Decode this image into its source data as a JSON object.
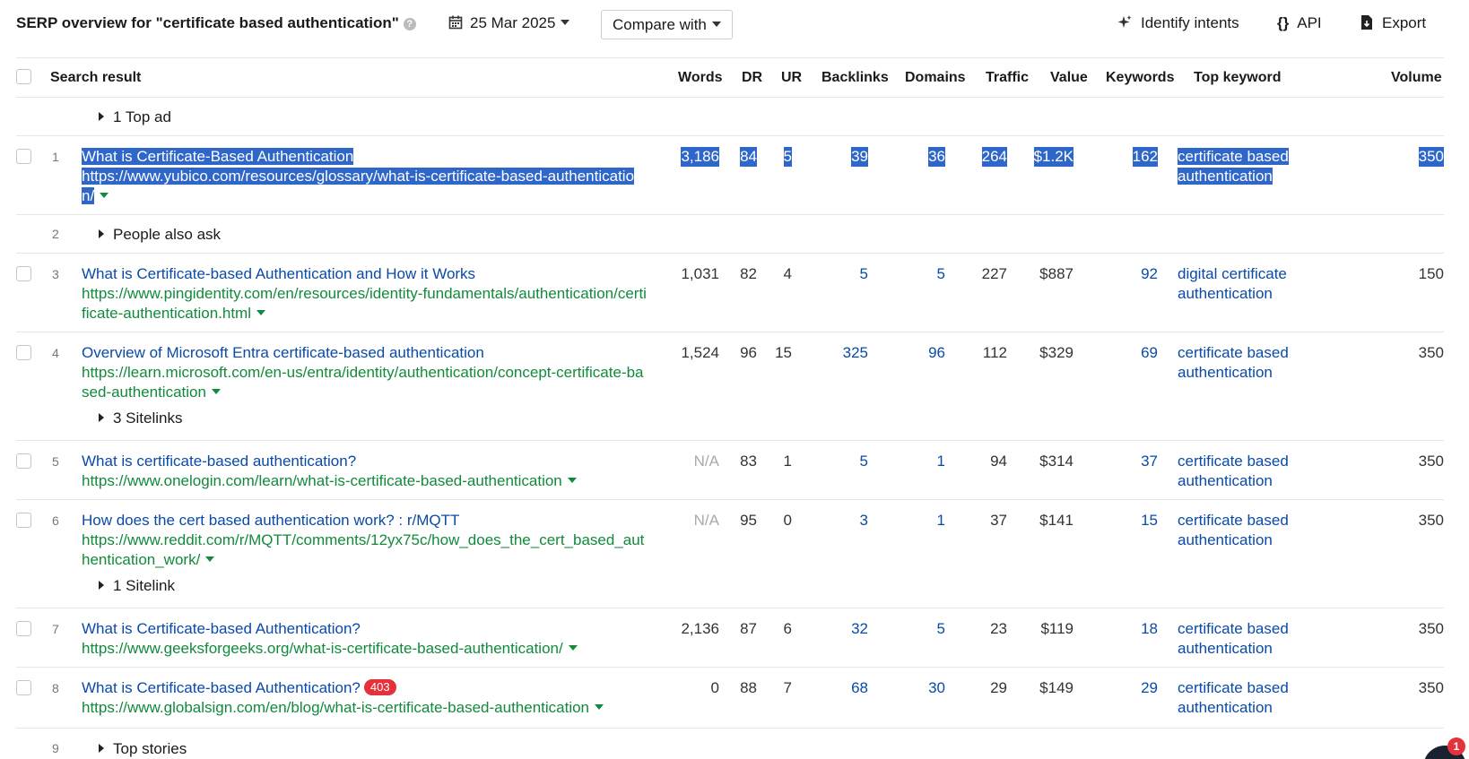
{
  "header": {
    "title": "SERP overview for \"certificate based authentication\"",
    "date": "25 Mar 2025",
    "compare_label": "Compare with",
    "identify_intents": "Identify intents",
    "api": "API",
    "api_glyph": "{}",
    "export": "Export"
  },
  "columns": {
    "result": "Search result",
    "words": "Words",
    "dr": "DR",
    "ur": "UR",
    "backlinks": "Backlinks",
    "domains": "Domains",
    "traffic": "Traffic",
    "value": "Value",
    "keywords": "Keywords",
    "top_keyword": "Top keyword",
    "volume": "Volume"
  },
  "features": {
    "top_ad": "1 Top ad",
    "paa_num": "2",
    "paa": "People also ask",
    "sitelinks_4": "3 Sitelinks",
    "sitelinks_6": "1 Sitelink",
    "stories_num": "9",
    "stories": "Top stories"
  },
  "rows": [
    {
      "num": "1",
      "title": "What is Certificate-Based Authentication",
      "url": "https://www.yubico.com/resources/glossary/what-is-certificate-based-authentication/",
      "words": "3,186",
      "dr": "84",
      "ur": "5",
      "backlinks": "39",
      "domains": "36",
      "traffic": "264",
      "value": "$1.2K",
      "keywords": "162",
      "top_keyword": "certificate based authentication",
      "volume": "350"
    },
    {
      "num": "3",
      "title": "What is Certificate-based Authentication and How it Works",
      "url": "https://www.pingidentity.com/en/resources/identity-fundamentals/authentication/certificate-authentication.html",
      "words": "1,031",
      "dr": "82",
      "ur": "4",
      "backlinks": "5",
      "domains": "5",
      "traffic": "227",
      "value": "$887",
      "keywords": "92",
      "top_keyword": "digital certificate authentication",
      "volume": "150"
    },
    {
      "num": "4",
      "title": "Overview of Microsoft Entra certificate-based authentication",
      "url": "https://learn.microsoft.com/en-us/entra/identity/authentication/concept-certificate-based-authentication",
      "words": "1,524",
      "dr": "96",
      "ur": "15",
      "backlinks": "325",
      "domains": "96",
      "traffic": "112",
      "value": "$329",
      "keywords": "69",
      "top_keyword": "certificate based authentication",
      "volume": "350"
    },
    {
      "num": "5",
      "title": "What is certificate-based authentication?",
      "url": "https://www.onelogin.com/learn/what-is-certificate-based-authentication",
      "words": "N/A",
      "dr": "83",
      "ur": "1",
      "backlinks": "5",
      "domains": "1",
      "traffic": "94",
      "value": "$314",
      "keywords": "37",
      "top_keyword": "certificate based authentication",
      "volume": "350"
    },
    {
      "num": "6",
      "title": "How does the cert based authentication work? : r/MQTT",
      "url": "https://www.reddit.com/r/MQTT/comments/12yx75c/how_does_the_cert_based_authentication_work/",
      "words": "N/A",
      "dr": "95",
      "ur": "0",
      "backlinks": "3",
      "domains": "1",
      "traffic": "37",
      "value": "$141",
      "keywords": "15",
      "top_keyword": "certificate based authentication",
      "volume": "350"
    },
    {
      "num": "7",
      "title": "What is Certificate-based Authentication?",
      "url": "https://www.geeksforgeeks.org/what-is-certificate-based-authentication/",
      "words": "2,136",
      "dr": "87",
      "ur": "6",
      "backlinks": "32",
      "domains": "5",
      "traffic": "23",
      "value": "$119",
      "keywords": "18",
      "top_keyword": "certificate based authentication",
      "volume": "350"
    },
    {
      "num": "8",
      "title": "What is Certificate-based Authentication?",
      "badge": "403",
      "url": "https://www.globalsign.com/en/blog/what-is-certificate-based-authentication",
      "words": "0",
      "dr": "88",
      "ur": "7",
      "backlinks": "68",
      "domains": "30",
      "traffic": "29",
      "value": "$149",
      "keywords": "29",
      "top_keyword": "certificate based authentication",
      "volume": "350"
    }
  ],
  "chat": {
    "notification_count": "1"
  }
}
